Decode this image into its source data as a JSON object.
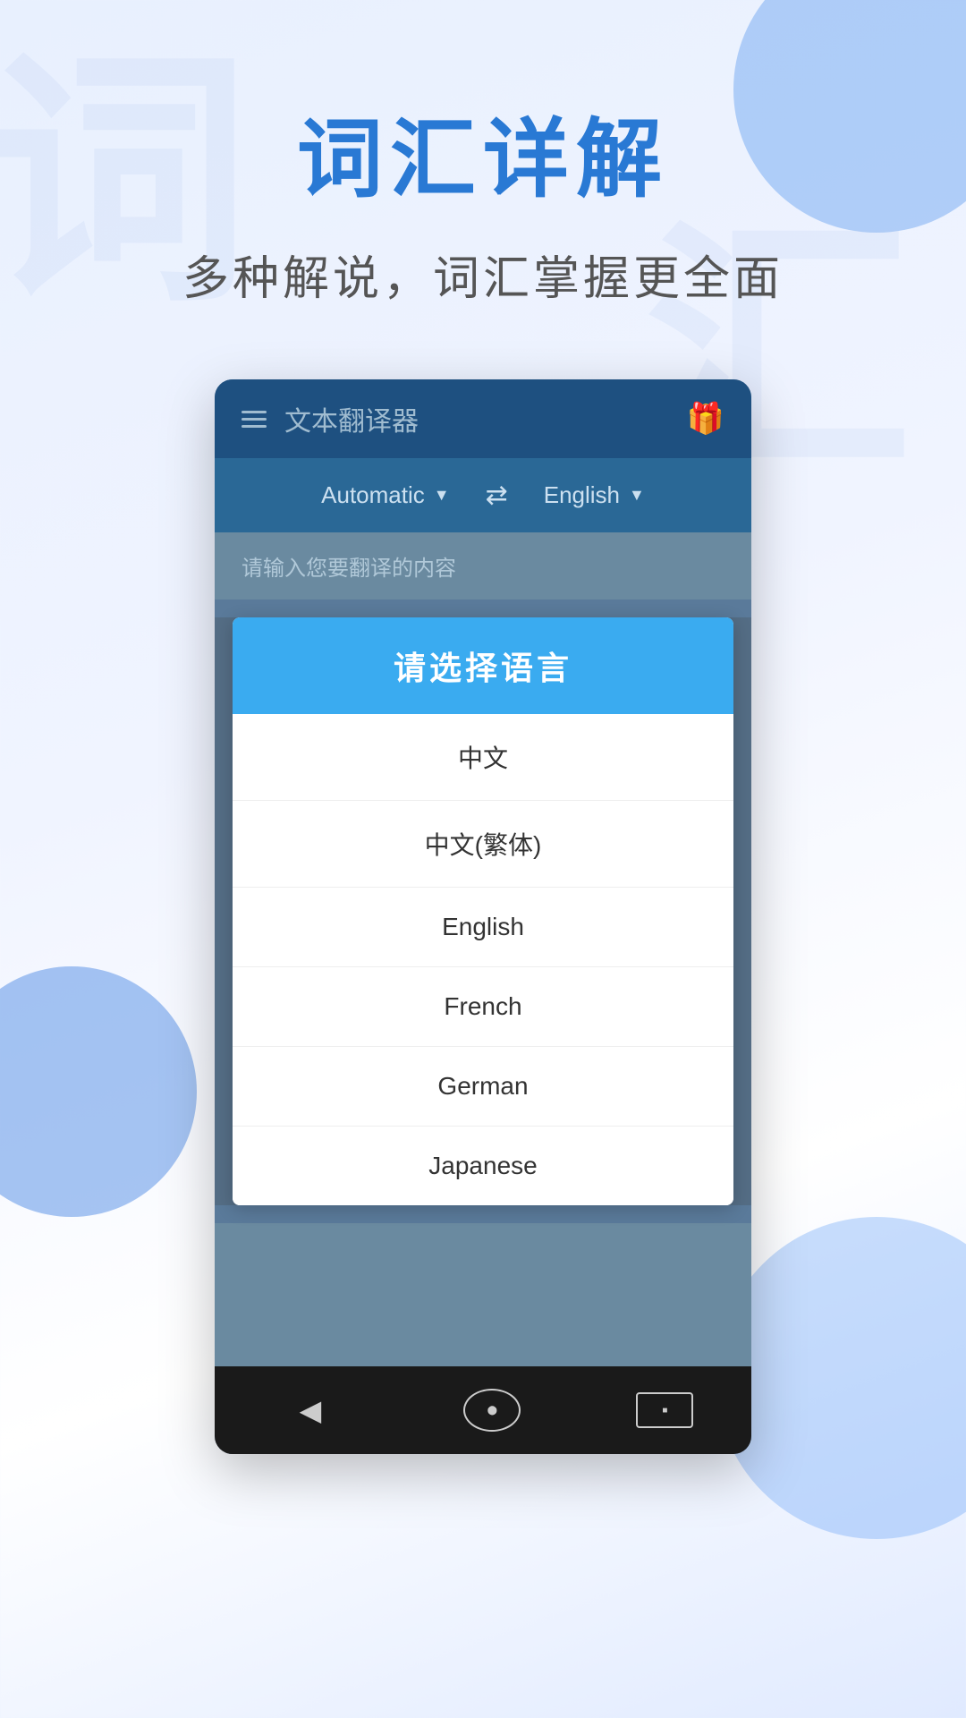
{
  "page": {
    "background": "#e8f0fe"
  },
  "hero": {
    "title": "词汇详解",
    "subtitle": "多种解说，词汇掌握更全面"
  },
  "app": {
    "header": {
      "title": "文本翻译器",
      "gift_icon": "🎁"
    },
    "lang_bar": {
      "source_lang": "Automatic",
      "target_lang": "English",
      "swap_symbol": "⇄"
    },
    "input_placeholder": "请输入您要翻译的内容"
  },
  "dialog": {
    "title": "请选择语言",
    "items": [
      {
        "label": "中文"
      },
      {
        "label": "中文(繁体)"
      },
      {
        "label": "English"
      },
      {
        "label": "French"
      },
      {
        "label": "German"
      },
      {
        "label": "Japanese"
      }
    ]
  },
  "bottom_nav": {
    "back_symbol": "◀",
    "home_symbol": "⬤",
    "recent_symbol": "■"
  },
  "watermarks": {
    "char1": "词",
    "char2": "汇"
  }
}
